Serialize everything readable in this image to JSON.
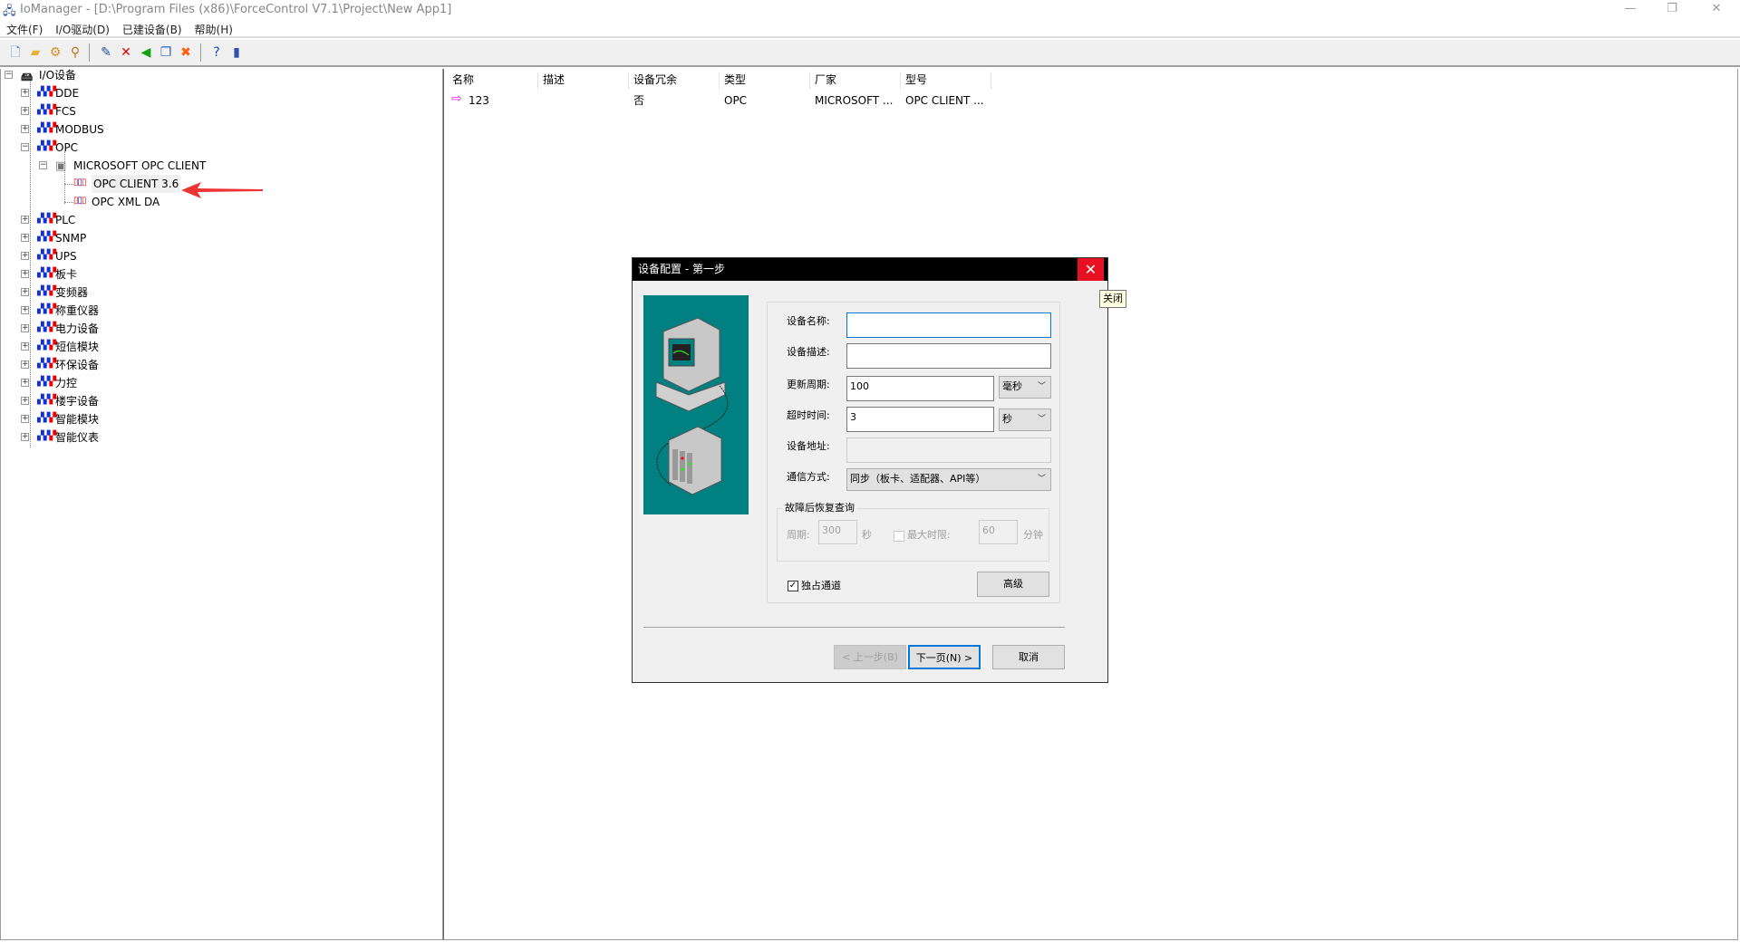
{
  "window": {
    "title": "IoManager - [D:\\Program Files (x86)\\ForceControl V7.1\\Project\\New App1]",
    "minimize": "—",
    "restore": "❐",
    "close": "✕"
  },
  "menu": [
    "文件(F)",
    "I/O驱动(D)",
    "已建设备(B)",
    "帮助(H)"
  ],
  "toolbar": [
    {
      "icon": "new-file-icon",
      "glyph": "🗋",
      "color": "#4a7bd0"
    },
    {
      "icon": "open-folder-icon",
      "glyph": "▰",
      "color": "#e6b030"
    },
    {
      "icon": "driver-icon",
      "glyph": "⚙",
      "color": "#d89020"
    },
    {
      "icon": "search-icon",
      "glyph": "⚲",
      "color": "#c07020"
    },
    {
      "icon": "edit-icon",
      "glyph": "✎",
      "color": "#2050a0"
    },
    {
      "icon": "delete-icon",
      "glyph": "✕",
      "color": "#e00000"
    },
    {
      "icon": "back-icon",
      "glyph": "◀",
      "color": "#10a010"
    },
    {
      "icon": "copy-config-icon",
      "glyph": "❐",
      "color": "#3060c0"
    },
    {
      "icon": "delete-all-icon",
      "glyph": "✖",
      "color": "#ff6010"
    },
    {
      "icon": "help-icon",
      "glyph": "?",
      "color": "#1050c0"
    },
    {
      "icon": "exit-icon",
      "glyph": "▮",
      "color": "#3050b0"
    }
  ],
  "tree": {
    "root": "I/O设备",
    "top": [
      "DDE",
      "FCS",
      "MODBUS",
      "OPC"
    ],
    "opc_child": "MICROSOFT OPC CLIENT",
    "opc_leaves": [
      "OPC CLIENT 3.6",
      "OPC XML DA"
    ],
    "rest": [
      "PLC",
      "SNMP",
      "UPS",
      "板卡",
      "变频器",
      "称重仪器",
      "电力设备",
      "短信模块",
      "环保设备",
      "力控",
      "楼宇设备",
      "智能模块",
      "智能仪表"
    ]
  },
  "list": {
    "columns": [
      "名称",
      "描述",
      "设备冗余",
      "类型",
      "厂家",
      "型号"
    ],
    "rows": [
      {
        "name": "123",
        "desc": "",
        "redundant": "否",
        "type": "OPC",
        "vendor": "MICROSOFT ...",
        "model": "OPC CLIENT ..."
      }
    ]
  },
  "dialog": {
    "title": "设备配置 - 第一步",
    "close_tooltip": "关闭",
    "close_glyph": "✕",
    "device_name_label": "设备名称:",
    "device_name": "",
    "device_desc_label": "设备描述:",
    "device_desc": "",
    "update_label": "更新周期:",
    "update_value": "100",
    "update_unit": "毫秒",
    "timeout_label": "超时时间:",
    "timeout_value": "3",
    "timeout_unit": "秒",
    "address_label": "设备地址:",
    "address_value": "",
    "comm_label": "通信方式:",
    "comm_value": "同步（板卡、适配器、API等）",
    "recovery_group": "故障后恢复查询",
    "period_label": "周期:",
    "period_value": "300",
    "period_unit": "秒",
    "max_label": "最大时限:",
    "max_value": "60",
    "max_unit": "分钟",
    "max_checked": false,
    "exclusive_label": "独占通道",
    "exclusive_checked": true,
    "advanced": "高级",
    "prev": "< 上一步(B)",
    "next": "下一页(N) >",
    "cancel": "取消"
  },
  "colors": {
    "accent": "#0078d7",
    "close_red": "#e81123",
    "teal": "#008080",
    "arrow": "#ee3333"
  }
}
